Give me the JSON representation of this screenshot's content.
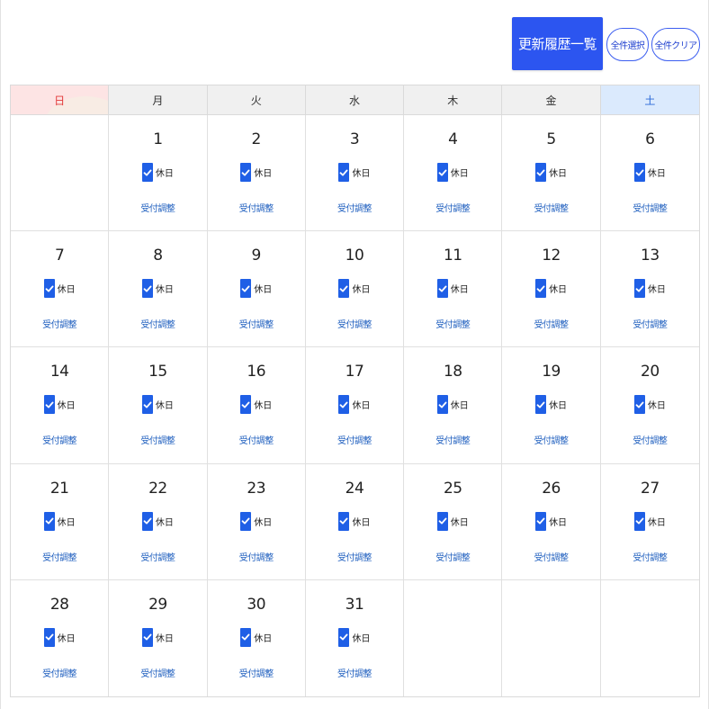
{
  "toolbar": {
    "history_label": "更新履歴一覧",
    "select_all_label": "全件選択",
    "clear_all_label": "全件クリア"
  },
  "weekdays": [
    "日",
    "月",
    "火",
    "水",
    "木",
    "金",
    "土"
  ],
  "cell_labels": {
    "holiday": "休日",
    "adjust": "受付調整"
  },
  "days": [
    {
      "day": "1",
      "weekday": "月",
      "holiday": true
    },
    {
      "day": "2",
      "weekday": "火",
      "holiday": true
    },
    {
      "day": "3",
      "weekday": "水",
      "holiday": true
    },
    {
      "day": "4",
      "weekday": "木",
      "holiday": true
    },
    {
      "day": "5",
      "weekday": "金",
      "holiday": true
    },
    {
      "day": "6",
      "weekday": "土",
      "holiday": true
    },
    {
      "day": "7",
      "weekday": "日",
      "holiday": true
    },
    {
      "day": "8",
      "weekday": "月",
      "holiday": true
    },
    {
      "day": "9",
      "weekday": "火",
      "holiday": true
    },
    {
      "day": "10",
      "weekday": "水",
      "holiday": true
    },
    {
      "day": "11",
      "weekday": "木",
      "holiday": true
    },
    {
      "day": "12",
      "weekday": "金",
      "holiday": true
    },
    {
      "day": "13",
      "weekday": "土",
      "holiday": true
    },
    {
      "day": "14",
      "weekday": "日",
      "holiday": true
    },
    {
      "day": "15",
      "weekday": "月",
      "holiday": true
    },
    {
      "day": "16",
      "weekday": "火",
      "holiday": true
    },
    {
      "day": "17",
      "weekday": "水",
      "holiday": true
    },
    {
      "day": "18",
      "weekday": "木",
      "holiday": true
    },
    {
      "day": "19",
      "weekday": "金",
      "holiday": true
    },
    {
      "day": "20",
      "weekday": "土",
      "holiday": true
    },
    {
      "day": "21",
      "weekday": "日",
      "holiday": true
    },
    {
      "day": "22",
      "weekday": "月",
      "holiday": true
    },
    {
      "day": "23",
      "weekday": "火",
      "holiday": true
    },
    {
      "day": "24",
      "weekday": "水",
      "holiday": true
    },
    {
      "day": "25",
      "weekday": "木",
      "holiday": true
    },
    {
      "day": "26",
      "weekday": "金",
      "holiday": true
    },
    {
      "day": "27",
      "weekday": "土",
      "holiday": true
    },
    {
      "day": "28",
      "weekday": "日",
      "holiday": true
    },
    {
      "day": "29",
      "weekday": "月",
      "holiday": true
    },
    {
      "day": "30",
      "weekday": "火",
      "holiday": true
    },
    {
      "day": "31",
      "weekday": "水",
      "holiday": true
    }
  ],
  "colors": {
    "accent": "#2c55f0",
    "checkbox": "#1f5fe6",
    "sunday": "#e23a3a",
    "saturday": "#2b6ad8",
    "link": "#1f5fbf"
  }
}
